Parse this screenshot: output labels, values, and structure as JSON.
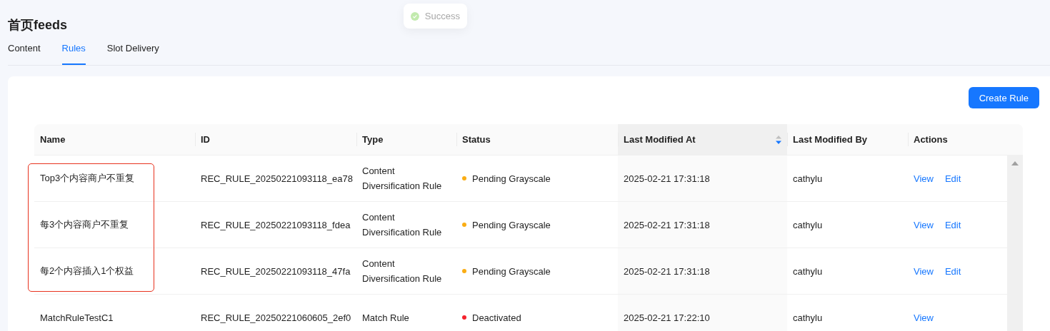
{
  "toast": {
    "text": "Success"
  },
  "page": {
    "title": "首页feeds"
  },
  "tabs": [
    {
      "label": "Content",
      "selected": false
    },
    {
      "label": "Rules",
      "selected": true
    },
    {
      "label": "Slot Delivery",
      "selected": false
    }
  ],
  "create_button": "Create Rule",
  "table": {
    "columns": [
      {
        "label": "Name",
        "sorted": false
      },
      {
        "label": "ID",
        "sorted": false
      },
      {
        "label": "Type",
        "sorted": false
      },
      {
        "label": "Status",
        "sorted": false
      },
      {
        "label": "Last Modified At",
        "sorted": true
      },
      {
        "label": "Last Modified By",
        "sorted": false
      },
      {
        "label": "Actions",
        "sorted": false
      }
    ],
    "rows": [
      {
        "name": "Top3个内容商户不重复",
        "id": "REC_RULE_20250221093118_ea78",
        "type": "Content Diversification Rule",
        "status": "Pending Grayscale",
        "color": "#faad14",
        "modified_at": "2025-02-21 17:31:18",
        "modified_by": "cathylu",
        "actions": [
          "View",
          "Edit"
        ],
        "highlighted": true
      },
      {
        "name": "每3个内容商户不重复",
        "id": "REC_RULE_20250221093118_fdea",
        "type": "Content Diversification Rule",
        "status": "Pending Grayscale",
        "color": "#faad14",
        "modified_at": "2025-02-21 17:31:18",
        "modified_by": "cathylu",
        "actions": [
          "View",
          "Edit"
        ],
        "highlighted": true
      },
      {
        "name": "每2个内容插入1个权益",
        "id": "REC_RULE_20250221093118_47fa",
        "type": "Content Diversification Rule",
        "status": "Pending Grayscale",
        "color": "#faad14",
        "modified_at": "2025-02-21 17:31:18",
        "modified_by": "cathylu",
        "actions": [
          "View",
          "Edit"
        ],
        "highlighted": true
      },
      {
        "name": "MatchRuleTestC1",
        "id": "REC_RULE_20250221060605_2ef0",
        "type": "Match Rule",
        "status": "Deactivated",
        "color": "#f5222d",
        "modified_at": "2025-02-21 17:22:10",
        "modified_by": "cathylu",
        "actions": [
          "View"
        ],
        "highlighted": false
      }
    ]
  }
}
